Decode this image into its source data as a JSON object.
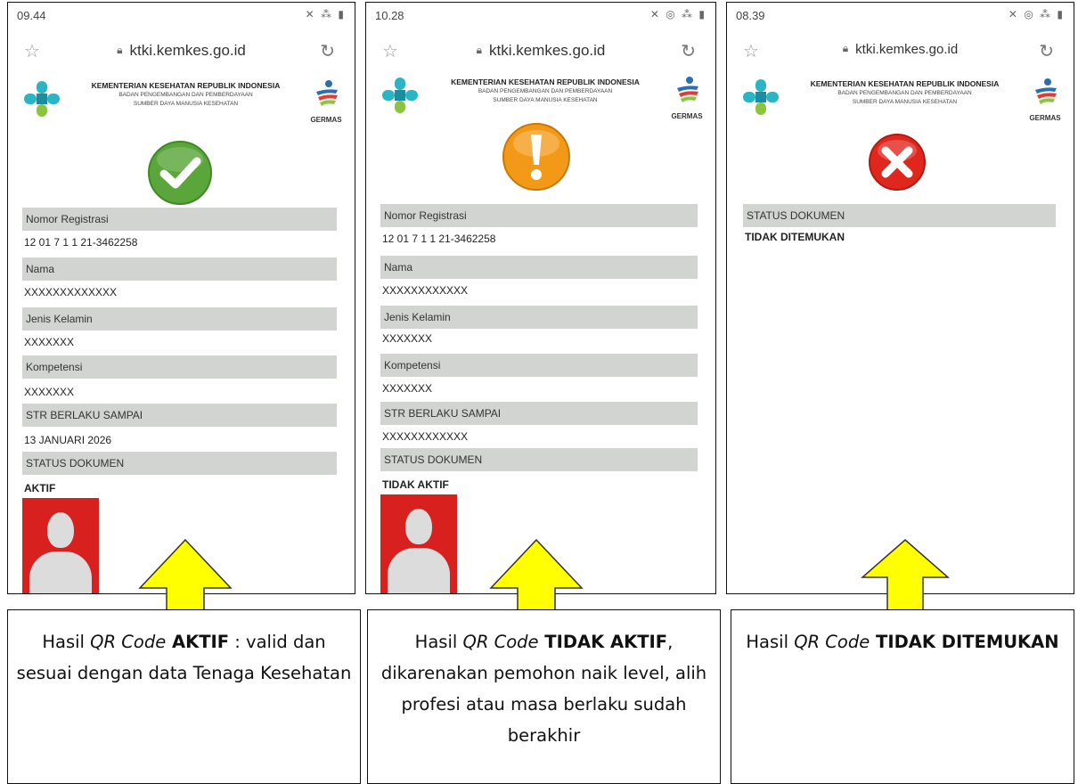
{
  "url": "ktki.kemkes.go.id",
  "header": {
    "ministry": "KEMENTERIAN KESEHATAN REPUBLIK INDONESIA",
    "agency_line1": "BADAN PENGEMBANGAN DAN PEMBERDAYAAN",
    "agency_line2": "SUMBER DAYA MANUSIA KESEHATAN",
    "germas": "GERMAS"
  },
  "labels": {
    "nomor_registrasi": "Nomor Registrasi",
    "nama": "Nama",
    "jenis_kelamin": "Jenis Kelamin",
    "kompetensi": "Kompetensi",
    "str_berlaku": "STR BERLAKU SAMPAI",
    "status_dokumen": "STATUS DOKUMEN"
  },
  "screens": [
    {
      "time": "09.44",
      "status_icon": "check-icon",
      "nomor_registrasi": "12 01 7 1 1 21-3462258",
      "nama": "XXXXXXXXXXXXX",
      "jenis_kelamin": "XXXXXXX",
      "kompetensi": "XXXXXXX",
      "str_berlaku": "13 JANUARI 2026",
      "status_dokumen": "AKTIF"
    },
    {
      "time": "10.28",
      "status_icon": "warning-icon",
      "nomor_registrasi": "12 01 7 1 1 21-3462258",
      "nama": "XXXXXXXXXXXX",
      "jenis_kelamin": "XXXXXXX",
      "kompetensi": "XXXXXXX",
      "str_berlaku": "XXXXXXXXXXXX",
      "status_dokumen": "TIDAK AKTIF"
    },
    {
      "time": "08.39",
      "status_icon": "error-icon",
      "status_dokumen": "TIDAK DITEMUKAN"
    }
  ],
  "captions": [
    {
      "prefix": "Hasil ",
      "italic": "QR Code",
      "bold": " AKTIF",
      "suffix": " : valid dan sesuai dengan data Tenaga Kesehatan"
    },
    {
      "prefix": "Hasil ",
      "italic": "QR Code",
      "bold": " TIDAK AKTIF",
      "suffix": ", dikarenakan pemohon naik level, alih profesi atau masa berlaku sudah berakhir"
    },
    {
      "prefix": "Hasil ",
      "italic": "QR Code",
      "bold": " TIDAK DITEMUKAN",
      "suffix": ""
    }
  ],
  "colors": {
    "arrow": "#ffff00",
    "check": "#5aa63a",
    "warning": "#f29a18",
    "error": "#e0271e",
    "photo_bg": "#d8201e",
    "field_bg": "#d2d4d2"
  }
}
